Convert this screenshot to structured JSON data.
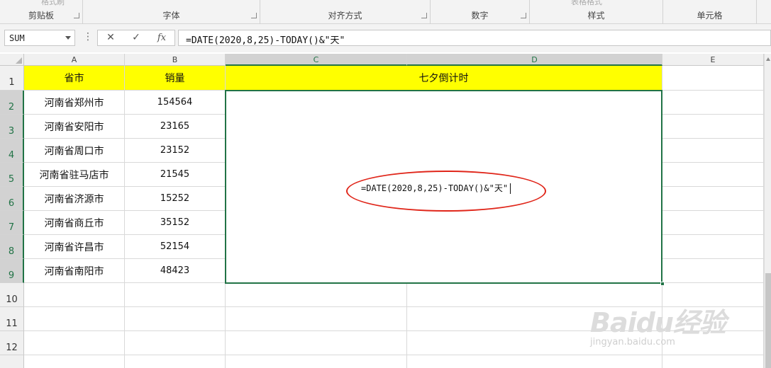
{
  "ribbon": {
    "groups": [
      "剪贴板",
      "字体",
      "对齐方式",
      "数字",
      "样式",
      "单元格"
    ],
    "faded_top": [
      "格式刷",
      "表格格式"
    ]
  },
  "formula_bar": {
    "name_box": "SUM",
    "dots": "⋮",
    "cancel": "✕",
    "enter": "✓",
    "fx": "fx",
    "formula": "=DATE(2020,8,25)-TODAY()&\"天\""
  },
  "columns": [
    "A",
    "B",
    "C",
    "D",
    "E"
  ],
  "rows": [
    "1",
    "2",
    "3",
    "4",
    "5",
    "6",
    "7",
    "8",
    "9",
    "10",
    "11",
    "12"
  ],
  "header": {
    "a": "省市",
    "b": "销量",
    "cd": "七夕倒计时"
  },
  "data_rows": [
    {
      "city": "河南省郑州市",
      "sales": "154564"
    },
    {
      "city": "河南省安阳市",
      "sales": "23165"
    },
    {
      "city": "河南省周口市",
      "sales": "23152"
    },
    {
      "city": "河南省驻马店市",
      "sales": "21545"
    },
    {
      "city": "河南省济源市",
      "sales": "15252"
    },
    {
      "city": "河南省商丘市",
      "sales": "35152"
    },
    {
      "city": "河南省许昌市",
      "sales": "52154"
    },
    {
      "city": "河南省南阳市",
      "sales": "48423"
    }
  ],
  "editing_cell": {
    "text": "=DATE(2020,8,25)-TODAY()&\"天\""
  },
  "annotation_color": "#e0261a",
  "accent_color": "#217346",
  "watermark": {
    "logo": "Baidu经验",
    "site": "jingyan.baidu.com"
  }
}
